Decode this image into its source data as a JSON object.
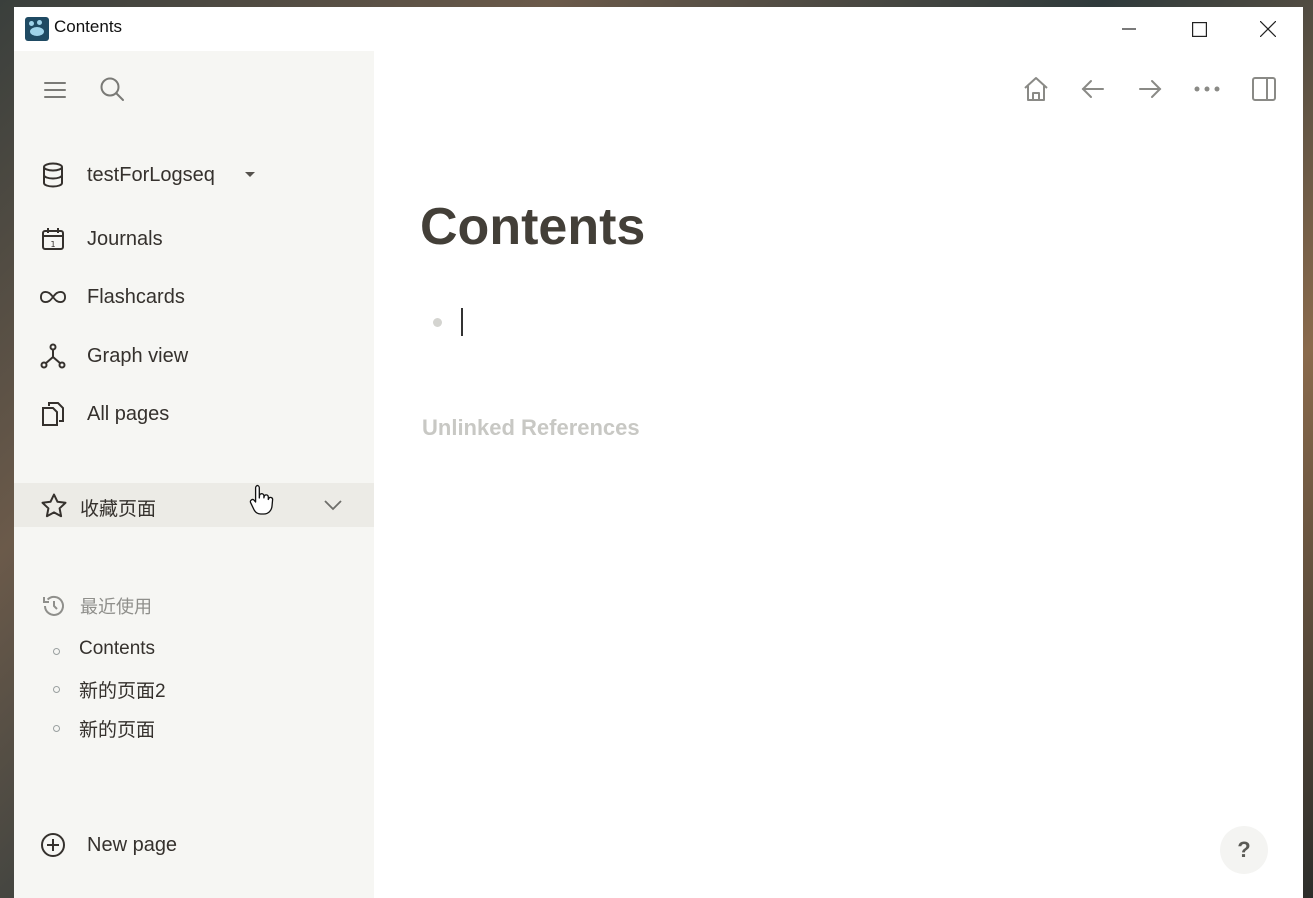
{
  "window": {
    "title": "Contents"
  },
  "sidebar": {
    "graph_name": "testForLogseq",
    "nav": [
      {
        "label": "Journals",
        "icon": "calendar-icon"
      },
      {
        "label": "Flashcards",
        "icon": "infinity-icon"
      },
      {
        "label": "Graph view",
        "icon": "graph-icon"
      },
      {
        "label": "All pages",
        "icon": "pages-icon"
      }
    ],
    "favorites_label": "收藏页面",
    "recent_label": "最近使用",
    "recent_items": [
      "Contents",
      "新的页面2",
      "新的页面"
    ],
    "new_page_label": "New page"
  },
  "main": {
    "page_title": "Contents",
    "unlinked_references": "Unlinked References",
    "help": "?"
  }
}
